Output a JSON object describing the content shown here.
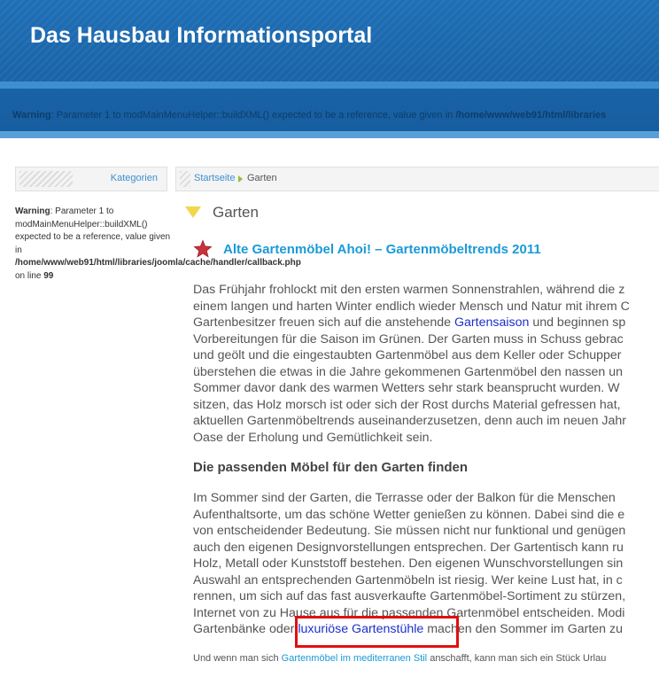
{
  "header": {
    "site_title": "Das Hausbau Informationsportal",
    "warning_label": "Warning",
    "warning_text": ": Parameter 1 to modMainMenuHelper::buildXML() expected to be a reference, value given in ",
    "warning_path": "/home/www/web91/html/libraries"
  },
  "sidebar": {
    "heading": "Kategorien",
    "warning_label": "Warning",
    "warning_text": ": Parameter 1 to modMainMenuHelper::buildXML() expected to be a reference, value given in",
    "warning_path": "/home/www/web91/html/libraries/joomla/cache/handler/callback.php",
    "line_prefix": "on line ",
    "line_number": "99"
  },
  "breadcrumb": {
    "home": "Startseite",
    "current": "Garten"
  },
  "category_title": "Garten",
  "article": {
    "title": "Alte Gartenmöbel Ahoi! – Gartenmöbeltrends 2011",
    "para1": [
      "Das Frühjahr frohlockt mit den ersten warmen Sonnenstrahlen, während die z",
      "einem langen und harten Winter endlich wieder Mensch und Natur mit ihrem C",
      {
        "before": "Gartenbesitzer freuen sich auf die anstehende ",
        "link": "Gartensaison",
        "after": " und beginnen sp"
      },
      "Vorbereitungen für die Saison im Grünen. Der Garten muss in Schuss gebrac",
      "und geölt und die eingestaubten Gartenmöbel aus dem Keller oder Schupper",
      "überstehen die etwas in die Jahre gekommenen Gartenmöbel den nassen un",
      "Sommer davor dank des warmen Wetters sehr stark beansprucht wurden. W",
      "sitzen, das Holz morsch ist oder sich der Rost durchs Material gefressen hat,",
      "aktuellen Gartenmöbeltrends auseinanderzusetzen, denn auch im neuen Jahr",
      "Oase der Erholung und Gemütlichkeit sein."
    ],
    "subheading": "Die passenden Möbel für den Garten finden",
    "para2": [
      "Im Sommer sind der Garten, die Terrasse oder der Balkon für die Menschen",
      "Aufenthaltsorte, um das schöne Wetter genießen zu können. Dabei sind die e",
      "von entscheidender Bedeutung. Sie müssen nicht nur funktional und genügen",
      "auch den eigenen Designvorstellungen entsprechen. Der Gartentisch kann ru",
      "Holz, Metall oder Kunststoff bestehen. Den eigenen Wunschvorstellungen sin",
      "Auswahl an entsprechenden Gartenmöbeln ist riesig. Wer keine Lust hat, in c",
      "rennen, um sich auf das fast ausverkaufte Gartenmöbel-Sortiment zu stürzen,",
      "Internet von zu Hause aus für die passenden Gartenmöbel entscheiden. Modi",
      {
        "before": "Gartenbänke oder ",
        "link": "luxuriöse Gartenstühle",
        "after": " machen den Sommer im Garten zu"
      }
    ],
    "small_before": "Und wenn man sich ",
    "small_link": "Gartenmöbel im mediterranen Stil",
    "small_after": " anschafft, kann man sich ein Stück Urlau"
  }
}
